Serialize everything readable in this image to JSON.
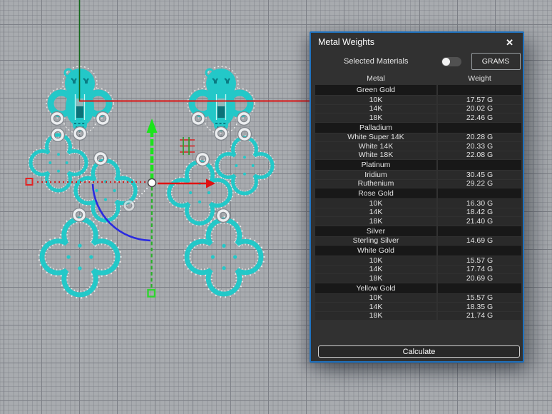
{
  "viewport": {
    "grid": {
      "background": "#a8abaf",
      "minor_line": "#797c84",
      "major_line": "#7c7f86"
    },
    "axes": {
      "x_axis_color": "#da1212",
      "y_axis_color": "#13661b"
    },
    "selection_color": "#23c8c8",
    "gizmo": {
      "move_x_color": "#e01212",
      "move_y_color": "#1ce41c",
      "rotate_arc_color": "#2a2ae0",
      "origin_dot_color": "#ffffff",
      "anchor_square_red": "#e32222",
      "anchor_square_green": "#2fd42f"
    }
  },
  "panel": {
    "title": "Metal Weights",
    "close_icon": "✕",
    "selected_materials_label": "Selected Materials",
    "toggle_state": "off",
    "units_button_label": "GRAMS",
    "columns": {
      "metal": "Metal",
      "weight": "Weight"
    },
    "sections": [
      {
        "name": "Green Gold",
        "rows": [
          [
            "10K",
            "17.57 G"
          ],
          [
            "14K",
            "20.02 G"
          ],
          [
            "18K",
            "22.46 G"
          ]
        ]
      },
      {
        "name": "Palladium",
        "rows": [
          [
            "White Super 14K",
            "20.28 G"
          ],
          [
            "White 14K",
            "20.33 G"
          ],
          [
            "White 18K",
            "22.08 G"
          ]
        ]
      },
      {
        "name": "Platinum",
        "rows": [
          [
            "Iridium",
            "30.45 G"
          ],
          [
            "Ruthenium",
            "29.22 G"
          ]
        ]
      },
      {
        "name": "Rose Gold",
        "rows": [
          [
            "10K",
            "16.30 G"
          ],
          [
            "14K",
            "18.42 G"
          ],
          [
            "18K",
            "21.40 G"
          ]
        ]
      },
      {
        "name": "Silver",
        "rows": [
          [
            "Sterling Silver",
            "14.69 G"
          ]
        ]
      },
      {
        "name": "White Gold",
        "rows": [
          [
            "10K",
            "15.57 G"
          ],
          [
            "14K",
            "17.74 G"
          ],
          [
            "18K",
            "20.69 G"
          ]
        ]
      },
      {
        "name": "Yellow Gold",
        "rows": [
          [
            "10K",
            "15.57 G"
          ],
          [
            "14K",
            "18.35 G"
          ],
          [
            "18K",
            "21.74 G"
          ]
        ]
      }
    ],
    "calculate_label": "Calculate"
  }
}
